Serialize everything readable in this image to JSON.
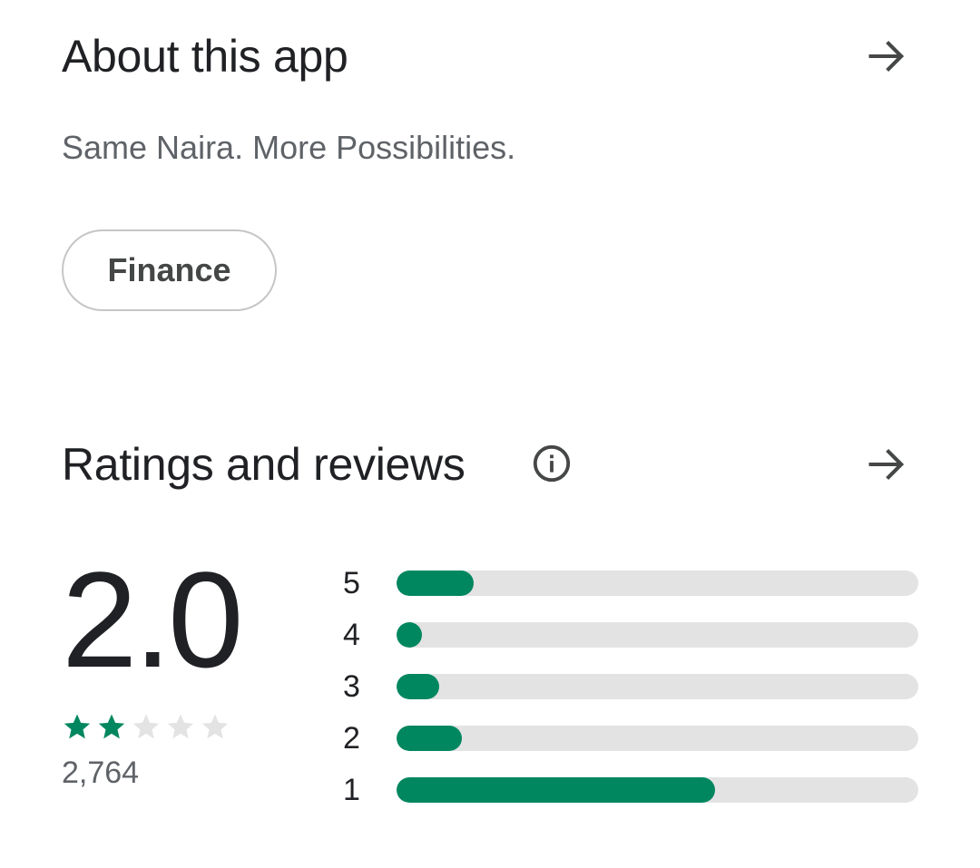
{
  "about": {
    "title": "About this app",
    "tagline": "Same Naira. More Possibilities.",
    "category_chip": "Finance",
    "arrow_icon": "arrow-right-icon"
  },
  "ratings": {
    "title": "Ratings and reviews",
    "info_icon": "info-icon",
    "arrow_icon": "arrow-right-icon",
    "average": "2.0",
    "stars_filled": 2,
    "stars_total": 5,
    "review_count": "2,764",
    "accent_color": "#01875f",
    "track_color": "#e3e3e3",
    "distribution": [
      {
        "label": "5",
        "fraction": 0.147
      },
      {
        "label": "4",
        "fraction": 0.049
      },
      {
        "label": "3",
        "fraction": 0.082
      },
      {
        "label": "2",
        "fraction": 0.125
      },
      {
        "label": "1",
        "fraction": 0.61
      }
    ]
  }
}
